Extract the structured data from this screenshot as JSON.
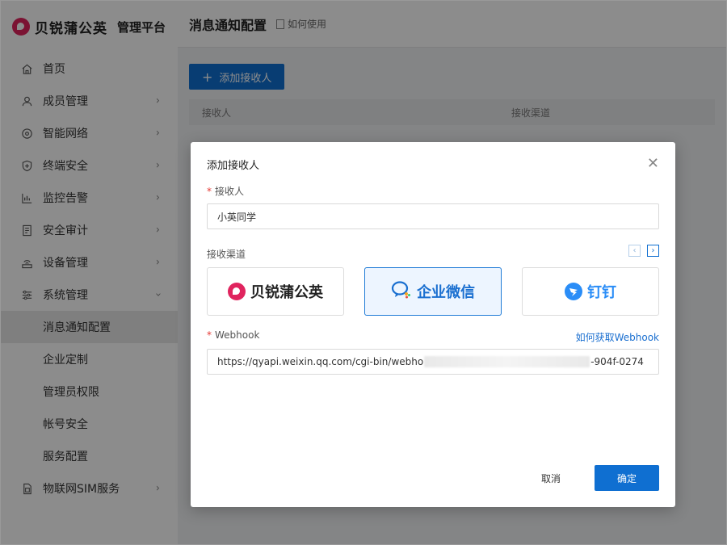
{
  "brand": {
    "name": "贝锐蒲公英",
    "subtitle": "管理平台"
  },
  "sidebar": {
    "items": [
      {
        "label": "首页",
        "icon": "home-icon"
      },
      {
        "label": "成员管理",
        "icon": "user-icon"
      },
      {
        "label": "智能网络",
        "icon": "network-icon"
      },
      {
        "label": "终端安全",
        "icon": "shield-icon"
      },
      {
        "label": "监控告警",
        "icon": "monitor-icon"
      },
      {
        "label": "安全审计",
        "icon": "audit-icon"
      },
      {
        "label": "设备管理",
        "icon": "device-icon"
      },
      {
        "label": "系统管理",
        "icon": "settings-icon"
      }
    ],
    "sub_items": [
      "消息通知配置",
      "企业定制",
      "管理员权限",
      "帐号安全",
      "服务配置"
    ],
    "last_item": {
      "label": "物联网SIM服务",
      "icon": "sim-icon"
    }
  },
  "header": {
    "title": "消息通知配置",
    "help": "如何使用"
  },
  "toolbar": {
    "add_label": "添加接收人"
  },
  "table": {
    "columns": [
      "接收人",
      "接收渠道"
    ]
  },
  "dialog": {
    "title": "添加接收人",
    "recipient_label": "接收人",
    "recipient_value": "小英同学",
    "channel_label": "接收渠道",
    "channels": [
      "贝锐蒲公英",
      "企业微信",
      "钉钉"
    ],
    "webhook_label": "Webhook",
    "webhook_help": "如何获取Webhook",
    "webhook_value_start": "https://qyapi.weixin.qq.com/cgi-bin/webho",
    "webhook_value_end": "-904f-0274",
    "cancel_label": "取消",
    "ok_label": "确定"
  },
  "colors": {
    "accent": "#0f6fd1",
    "brand": "#e0245e"
  }
}
